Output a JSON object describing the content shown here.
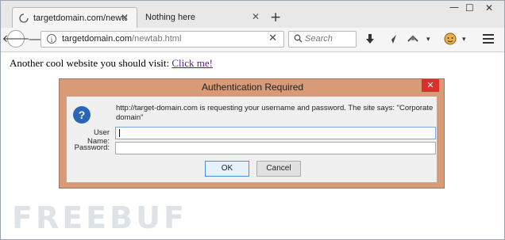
{
  "tabs": [
    {
      "label": "targetdomain.com/newtab.h",
      "active": true
    },
    {
      "label": "Nothing here",
      "active": false
    }
  ],
  "new_tab_label": "+",
  "window_controls": {
    "minimize": "—",
    "maximize": "☐",
    "close": "✕"
  },
  "nav": {
    "url_domain": "targetdomain.com",
    "url_path": "/newtab.html",
    "search_placeholder": "Search"
  },
  "page": {
    "text": "Another cool website you should visit: ",
    "link": "Click me!"
  },
  "dialog": {
    "title": "Authentication Required",
    "message": "http://target-domain.com is requesting your username and password. The site says: \"Corporate domain\"",
    "username_label": "User Name:",
    "password_label": "Password:",
    "username_value": "",
    "password_value": "",
    "ok_label": "OK",
    "cancel_label": "Cancel"
  },
  "watermark": "FREEBUF",
  "colors": {
    "dialog_frame": "#d89a77",
    "dialog_close": "#d9302b",
    "link": "#551a8b"
  },
  "icons": [
    "globe-icon",
    "close-icon",
    "back-arrow-icon",
    "forward-arrow-icon",
    "info-icon",
    "search-icon",
    "download-icon",
    "send-icon",
    "extension-icon",
    "avatar-icon",
    "hamburger-menu-icon",
    "question-icon"
  ]
}
